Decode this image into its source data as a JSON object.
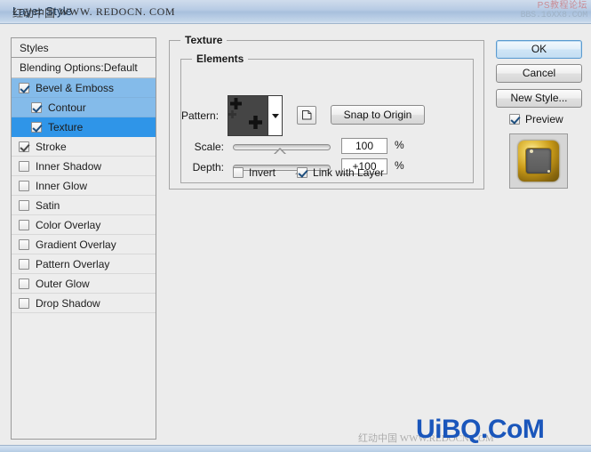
{
  "window": {
    "title": "Layer Style"
  },
  "watermarks": {
    "title_cn": "红动中国",
    "title_url": "WWW. REDOCN. COM",
    "top_right_cn": "PS教程论坛",
    "top_right_url": "BBS.16XX8.COM",
    "bottom_blue": "UiBQ.CoM",
    "bottom_gray": "红动中国 WWW.REDOCN.COM"
  },
  "styles_panel": {
    "header": "Styles",
    "blending_options": "Blending Options:Default",
    "items": [
      {
        "label": "Bevel & Emboss",
        "checked": true,
        "indent": false,
        "highlight": "light"
      },
      {
        "label": "Contour",
        "checked": true,
        "indent": true,
        "highlight": "light"
      },
      {
        "label": "Texture",
        "checked": true,
        "indent": true,
        "highlight": "dark"
      },
      {
        "label": "Stroke",
        "checked": true,
        "indent": false,
        "highlight": "none"
      },
      {
        "label": "Inner Shadow",
        "checked": false,
        "indent": false,
        "highlight": "none"
      },
      {
        "label": "Inner Glow",
        "checked": false,
        "indent": false,
        "highlight": "none"
      },
      {
        "label": "Satin",
        "checked": false,
        "indent": false,
        "highlight": "none"
      },
      {
        "label": "Color Overlay",
        "checked": false,
        "indent": false,
        "highlight": "none"
      },
      {
        "label": "Gradient Overlay",
        "checked": false,
        "indent": false,
        "highlight": "none"
      },
      {
        "label": "Pattern Overlay",
        "checked": false,
        "indent": false,
        "highlight": "none"
      },
      {
        "label": "Outer Glow",
        "checked": false,
        "indent": false,
        "highlight": "none"
      },
      {
        "label": "Drop Shadow",
        "checked": false,
        "indent": false,
        "highlight": "none"
      }
    ]
  },
  "texture": {
    "group_title": "Texture",
    "elements_title": "Elements",
    "pattern_label": "Pattern:",
    "pattern_swatch_bg": "#454545",
    "snap_to_origin_label": "Snap to Origin",
    "scale": {
      "label": "Scale:",
      "value": "100",
      "unit": "%",
      "thumb_percent": 48
    },
    "depth": {
      "label": "Depth:",
      "value": "+100",
      "unit": "%",
      "thumb_percent": 70
    },
    "invert": {
      "label": "Invert",
      "checked": false
    },
    "link_with_layer": {
      "label": "Link with Layer",
      "checked": true
    }
  },
  "buttons": {
    "ok": "OK",
    "cancel": "Cancel",
    "new_style": "New Style...",
    "preview": {
      "label": "Preview",
      "checked": true
    }
  },
  "colors": {
    "dialog_bg": "#ececec",
    "titlebar_blue": "#b7cbe4",
    "selection_dark": "#2f95e8",
    "selection_light": "#84bbea",
    "accent_blue": "#1a56bb"
  }
}
